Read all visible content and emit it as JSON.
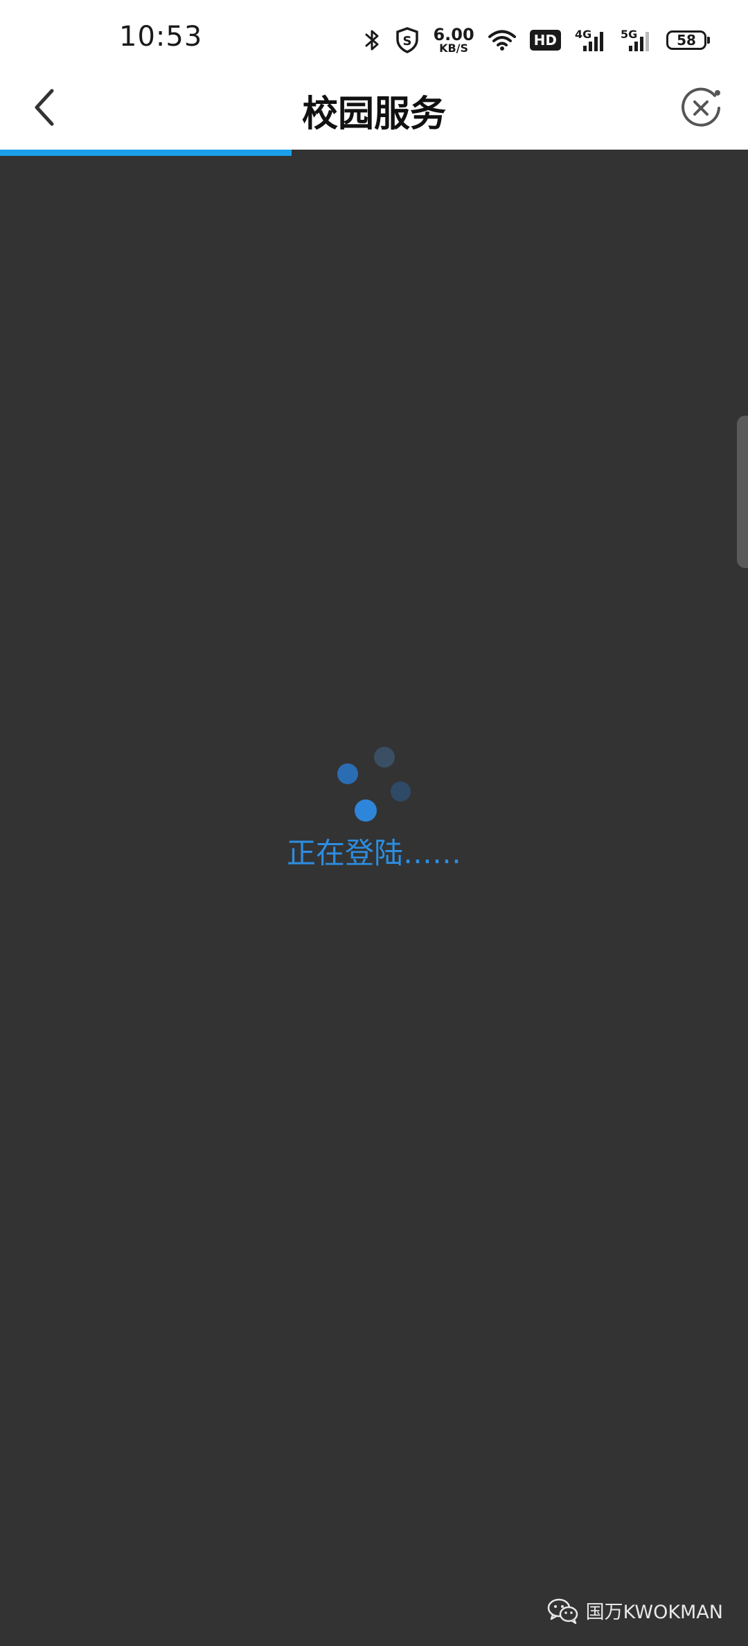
{
  "status_bar": {
    "time": "10:53",
    "net_speed_value": "6.00",
    "net_speed_unit": "KB/S",
    "hd_badge": "HD",
    "signal_1_label": "4G",
    "signal_2_label": "5G",
    "battery": "58"
  },
  "nav": {
    "title": "校园服务",
    "back_icon": "chevron-left-icon",
    "close_icon": "close-circle-icon"
  },
  "progress": {
    "fraction": 0.39,
    "color": "#1aa0ea"
  },
  "loading": {
    "text": "正在登陆……",
    "color": "#2d8de0"
  },
  "watermark": {
    "text": "国万KWOKMAN",
    "icon": "wechat-icon"
  },
  "colors": {
    "background": "#333333",
    "header": "#ffffff"
  }
}
